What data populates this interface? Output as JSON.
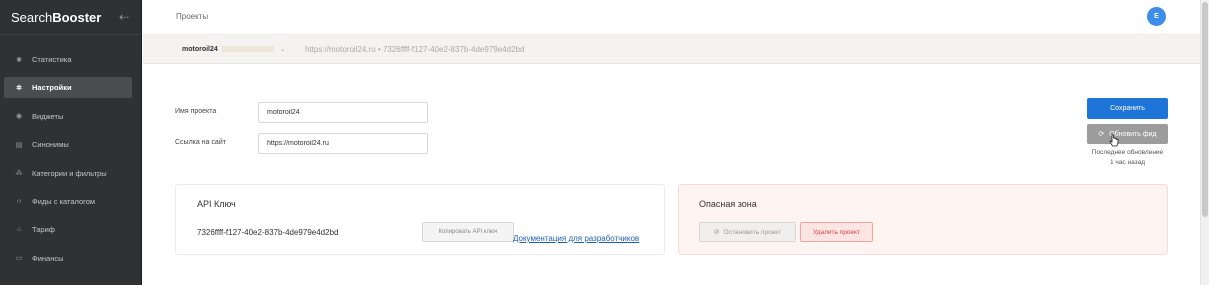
{
  "sidebar": {
    "logo_regular": "Search",
    "logo_bold": "Booster",
    "collapse_icon": "arrow-left-icon",
    "items": [
      {
        "label": "Статистика",
        "icon": "chart-icon",
        "glyph": "⬤"
      },
      {
        "label": "Настройки",
        "icon": "gear-icon",
        "glyph": "✲",
        "active": true
      },
      {
        "label": "Виджеты",
        "icon": "eye-icon",
        "glyph": "◉"
      },
      {
        "label": "Синонимы",
        "icon": "copy-icon",
        "glyph": "▤"
      },
      {
        "label": "Категории и фильтры",
        "icon": "category-icon",
        "glyph": "⁂"
      },
      {
        "label": "Фиды с каталогом",
        "icon": "code-icon",
        "glyph": "‹›"
      },
      {
        "label": "Тариф",
        "icon": "shopping-bag-icon",
        "glyph": "⌂"
      },
      {
        "label": "Финансы",
        "icon": "wallet-icon",
        "glyph": "▭"
      }
    ]
  },
  "header": {
    "breadcrumb": "Проекты",
    "avatar_letter": "E",
    "avatar_color": "#3d8ee8"
  },
  "subbar": {
    "project_name": "motoroil24",
    "project_info": "https://motoroil24.ru  •  7326ffff-f127-40e2-837b-4de979e4d2bd"
  },
  "form": {
    "name_label": "Имя проекта",
    "name_value": "motoroil24",
    "url_label": "Ссылка на сайт",
    "url_value": "https://motoroil24.ru"
  },
  "actions": {
    "save_label": "Сохранить",
    "refresh_label": "Обновить фид",
    "last_update_label": "Последнее обновление",
    "last_update_value": "1 час назад",
    "primary_color": "#1f74d8"
  },
  "api": {
    "title": "API Ключ",
    "key": "7326ffff-f127-40e2-837b-4de979e4d2bd",
    "copy_label": "Копировать API ключ",
    "docs_link": "Документация для разработчиков"
  },
  "danger": {
    "title": "Опасная зона",
    "stop_label": "Остановить проект",
    "delete_label": "Удалить проект",
    "delete_color": "#d8433d"
  }
}
